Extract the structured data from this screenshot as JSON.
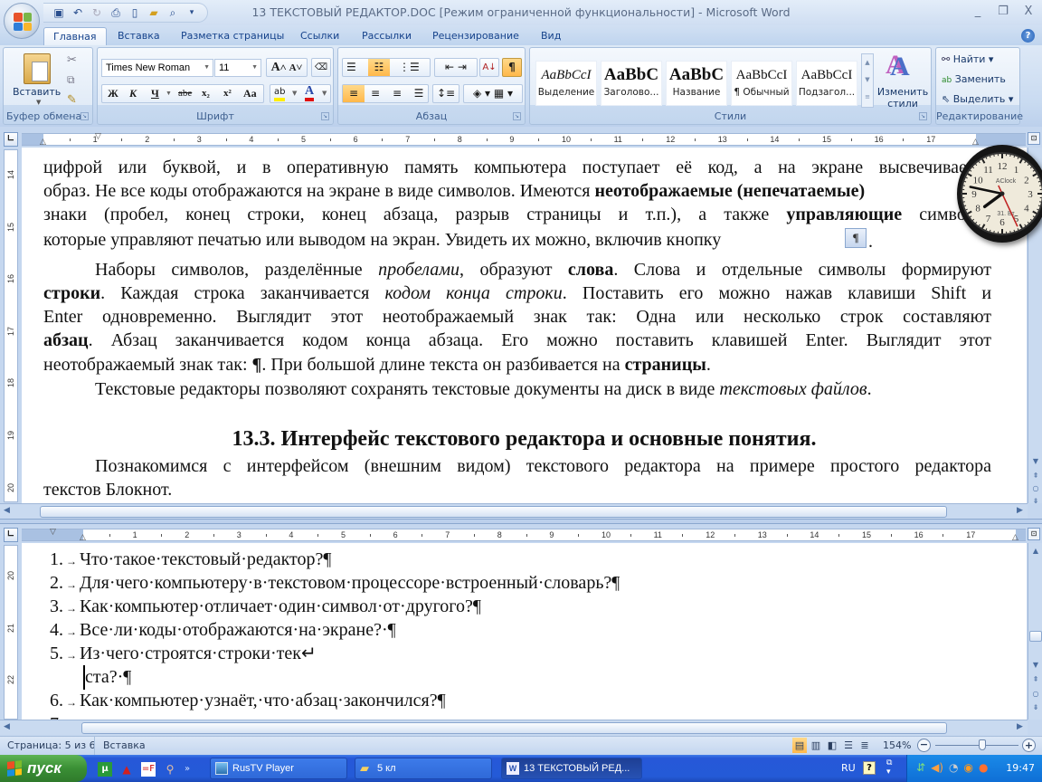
{
  "window": {
    "title": "13 ТЕКСТОВЫЙ РЕДАКТОР.DOC [Режим ограниченной функциональности] - Microsoft Word",
    "controls": {
      "minimize": "_",
      "restore": "❐",
      "close": "X"
    }
  },
  "quick_access": [
    "save-icon",
    "undo-icon",
    "redo-icon",
    "print-icon",
    "new-document-icon",
    "open-folder-icon",
    "print-preview-icon",
    "customize-qat-icon"
  ],
  "tabs": [
    {
      "label": "Главная",
      "active": true
    },
    {
      "label": "Вставка"
    },
    {
      "label": "Разметка страницы"
    },
    {
      "label": "Ссылки"
    },
    {
      "label": "Рассылки"
    },
    {
      "label": "Рецензирование"
    },
    {
      "label": "Вид"
    }
  ],
  "ribbon": {
    "clipboard": {
      "label": "Буфер обмена",
      "paste": "Вставить"
    },
    "font": {
      "label": "Шрифт",
      "font_name": "Times New Roman",
      "font_size": "11",
      "bold": "Ж",
      "italic": "К",
      "underline": "Ч",
      "strike": "abe",
      "subscript": "x₂",
      "superscript": "x²",
      "change_case": "Aa",
      "grow": "A",
      "shrink": "A"
    },
    "paragraph": {
      "label": "Абзац",
      "show_marks": "¶"
    },
    "styles": {
      "label": "Стили",
      "items": [
        {
          "sample": "AaBbCcI",
          "name": "Выделение"
        },
        {
          "sample": "AaBbC",
          "name": "Заголово..."
        },
        {
          "sample": "AaBbC",
          "name": "Название"
        },
        {
          "sample": "AaBbCcI",
          "name": "¶ Обычный"
        },
        {
          "sample": "AaBbCcI",
          "name": "Подзагол..."
        }
      ],
      "change_styles": "Изменить стили"
    },
    "editing": {
      "label": "Редактирование",
      "find": "Найти",
      "replace": "Заменить",
      "select": "Выделить"
    }
  },
  "ruler": {
    "numbers": [
      "1",
      "2",
      "3",
      "4",
      "5",
      "6",
      "7",
      "8",
      "9",
      "10",
      "11",
      "12",
      "13",
      "14",
      "15",
      "16",
      "17"
    ]
  },
  "vruler_top": [
    "14",
    "15",
    "16",
    "17",
    "18",
    "19",
    "20"
  ],
  "vruler_bottom": [
    "20",
    "21",
    "22"
  ],
  "document_top": {
    "lines": [
      {
        "text": "цифрой или буквой, и в оперативную память компьютера поступает её код, а на экране высвечивается"
      },
      {
        "parts": [
          {
            "t": "образ. Не все коды отображаются на экране в виде символов. Имеются "
          },
          {
            "t": "неотображаемые (непечатаемые)",
            "b": true
          }
        ]
      },
      {
        "parts": [
          {
            "t": "знаки (пробел, конец строки, конец абзаца, разрыв страницы и т.п.), а также "
          },
          {
            "t": "управляющие",
            "b": true
          },
          {
            "t": " символы,"
          }
        ]
      },
      {
        "text": "которые управляют печатью или выводом на экран. Увидеть их можно, включив кнопку"
      },
      {
        "parts": [
          {
            "t": "Наборы символов, разделённые "
          },
          {
            "t": "пробелами",
            "i": true
          },
          {
            "t": ", образуют "
          },
          {
            "t": "слова",
            "b": true
          },
          {
            "t": ". Слова и отдельные символы формируют"
          }
        ]
      },
      {
        "parts": [
          {
            "t": "строки",
            "b": true
          },
          {
            "t": ". Каждая строка заканчивается "
          },
          {
            "t": "кодом конца строки",
            "i": true
          },
          {
            "t": ". Поставить его можно нажав клавиши Shift и"
          }
        ]
      },
      {
        "text": "Enter одновременно.  Выглядит этот неотображаемый знак так: Одна или несколько строк составляют"
      },
      {
        "parts": [
          {
            "t": "абзац",
            "b": true
          },
          {
            "t": ". Абзац заканчивается кодом конца абзаца. Его можно поставить клавишей Enter. Выглядит этот"
          }
        ]
      },
      {
        "parts": [
          {
            "t": "неотображаемый знак так: "
          },
          {
            "t": "¶",
            "b": true
          },
          {
            "t": ". При большой длине текста он разбивается на  "
          },
          {
            "t": "страницы",
            "b": true
          },
          {
            "t": "."
          }
        ]
      },
      {
        "parts": [
          {
            "t": "Текстовые редакторы позволяют сохранять текстовые документы на диск в виде "
          },
          {
            "t": "текстовых файлов",
            "i": true
          },
          {
            "t": "."
          }
        ]
      }
    ],
    "heading": "13.3. Интерфейс текстового редактора и основные понятия.",
    "para_line1": "Познакомимся с интерфейсом (внешним видом) текстового редактора на примере простого редактора",
    "para_line2": "текстов Блокнот.",
    "inline_button": "¶"
  },
  "document_bottom": {
    "items": [
      {
        "num": "1.",
        "text": "Что·такое·текстовый·редактор?¶"
      },
      {
        "num": "2.",
        "text": "Для·чего·компьютеру·в·текстовом·процессоре·встроенный·словарь?¶"
      },
      {
        "num": "3.",
        "text": "Как·компьютер·отличает·один·символ·от·другого?¶"
      },
      {
        "num": "4.",
        "text": "Все·ли·коды·отображаются·на·экране?·¶"
      },
      {
        "num": "5.",
        "text": "Из·чего·строятся·строки·тек↵",
        "cont": "ста?·¶"
      },
      {
        "num": "6.",
        "text": "Как·компьютер·узнаёт,·что·абзац·закончился?¶"
      }
    ]
  },
  "clock_widget": {
    "brand": "AClock",
    "date": "31. Вт",
    "numbers": [
      "12",
      "1",
      "2",
      "3",
      "4",
      "5",
      "6",
      "7",
      "8",
      "9",
      "10",
      "11"
    ]
  },
  "statusbar": {
    "page": "Страница: 5 из 6",
    "mode": "Вставка",
    "zoom": "154%",
    "zoom_level_percent": 154
  },
  "taskbar": {
    "start": "пуск",
    "buttons": [
      {
        "label": "RusTV Player"
      },
      {
        "label": "5 кл"
      },
      {
        "label": "13 ТЕКСТОВЫЙ РЕД...",
        "active": true
      }
    ],
    "lang": "RU",
    "time": "19:47"
  }
}
